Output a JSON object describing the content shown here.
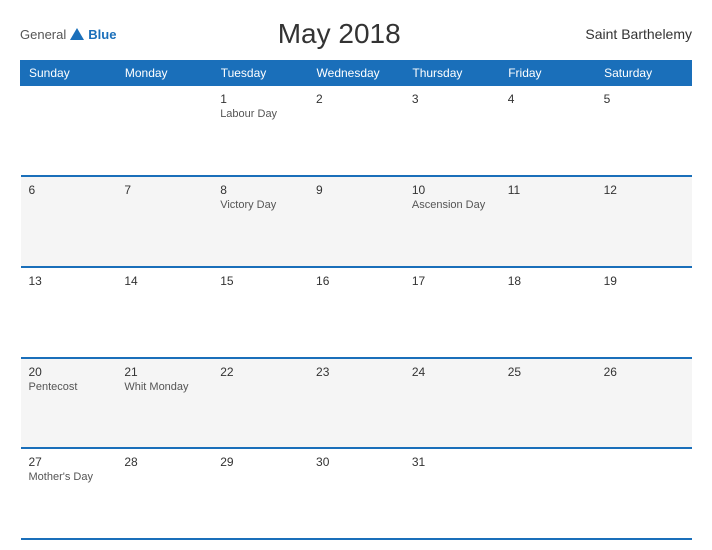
{
  "header": {
    "logo_general": "General",
    "logo_blue": "Blue",
    "title": "May 2018",
    "region": "Saint Barthelemy"
  },
  "columns": [
    "Sunday",
    "Monday",
    "Tuesday",
    "Wednesday",
    "Thursday",
    "Friday",
    "Saturday"
  ],
  "weeks": [
    [
      {
        "day": "",
        "event": ""
      },
      {
        "day": "",
        "event": ""
      },
      {
        "day": "1",
        "event": "Labour Day"
      },
      {
        "day": "2",
        "event": ""
      },
      {
        "day": "3",
        "event": ""
      },
      {
        "day": "4",
        "event": ""
      },
      {
        "day": "5",
        "event": ""
      }
    ],
    [
      {
        "day": "6",
        "event": ""
      },
      {
        "day": "7",
        "event": ""
      },
      {
        "day": "8",
        "event": "Victory Day"
      },
      {
        "day": "9",
        "event": ""
      },
      {
        "day": "10",
        "event": "Ascension Day"
      },
      {
        "day": "11",
        "event": ""
      },
      {
        "day": "12",
        "event": ""
      }
    ],
    [
      {
        "day": "13",
        "event": ""
      },
      {
        "day": "14",
        "event": ""
      },
      {
        "day": "15",
        "event": ""
      },
      {
        "day": "16",
        "event": ""
      },
      {
        "day": "17",
        "event": ""
      },
      {
        "day": "18",
        "event": ""
      },
      {
        "day": "19",
        "event": ""
      }
    ],
    [
      {
        "day": "20",
        "event": "Pentecost"
      },
      {
        "day": "21",
        "event": "Whit Monday"
      },
      {
        "day": "22",
        "event": ""
      },
      {
        "day": "23",
        "event": ""
      },
      {
        "day": "24",
        "event": ""
      },
      {
        "day": "25",
        "event": ""
      },
      {
        "day": "26",
        "event": ""
      }
    ],
    [
      {
        "day": "27",
        "event": "Mother's Day"
      },
      {
        "day": "28",
        "event": ""
      },
      {
        "day": "29",
        "event": ""
      },
      {
        "day": "30",
        "event": ""
      },
      {
        "day": "31",
        "event": ""
      },
      {
        "day": "",
        "event": ""
      },
      {
        "day": "",
        "event": ""
      }
    ]
  ]
}
